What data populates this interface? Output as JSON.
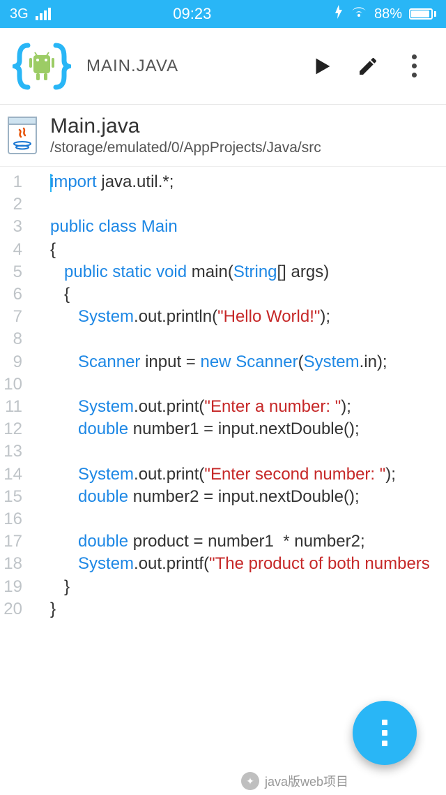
{
  "status": {
    "network": "3G",
    "time": "09:23",
    "battery_pct": "88%"
  },
  "appbar": {
    "title": "MAIN.JAVA"
  },
  "file": {
    "name": "Main.java",
    "path": "/storage/emulated/0/AppProjects/Java/src"
  },
  "code": {
    "lines": [
      [
        {
          "t": "import ",
          "c": "kw"
        },
        {
          "t": "java.util.*;",
          "c": "id"
        }
      ],
      [],
      [
        {
          "t": "public class ",
          "c": "kw"
        },
        {
          "t": "Main",
          "c": "cls"
        }
      ],
      [
        {
          "t": "{",
          "c": "id"
        }
      ],
      [
        {
          "t": "   ",
          "c": "id"
        },
        {
          "t": "public static ",
          "c": "kw"
        },
        {
          "t": "void ",
          "c": "cls"
        },
        {
          "t": "main",
          "c": "id"
        },
        {
          "t": "(",
          "c": "id"
        },
        {
          "t": "String",
          "c": "cls"
        },
        {
          "t": "[] args",
          "c": "id"
        },
        {
          "t": ")",
          "c": "id"
        }
      ],
      [
        {
          "t": "   {",
          "c": "id"
        }
      ],
      [
        {
          "t": "      ",
          "c": "id"
        },
        {
          "t": "System",
          "c": "sys"
        },
        {
          "t": ".out.println(",
          "c": "id"
        },
        {
          "t": "\"Hello World!\"",
          "c": "str"
        },
        {
          "t": ");",
          "c": "id"
        }
      ],
      [],
      [
        {
          "t": "      ",
          "c": "id"
        },
        {
          "t": "Scanner ",
          "c": "cls"
        },
        {
          "t": "input = ",
          "c": "id"
        },
        {
          "t": "new ",
          "c": "kw"
        },
        {
          "t": "Scanner",
          "c": "cls"
        },
        {
          "t": "(",
          "c": "id"
        },
        {
          "t": "System",
          "c": "sys"
        },
        {
          "t": ".in);",
          "c": "id"
        }
      ],
      [],
      [
        {
          "t": "      ",
          "c": "id"
        },
        {
          "t": "System",
          "c": "sys"
        },
        {
          "t": ".out.print(",
          "c": "id"
        },
        {
          "t": "\"Enter a number: \"",
          "c": "str"
        },
        {
          "t": ");",
          "c": "id"
        }
      ],
      [
        {
          "t": "      ",
          "c": "id"
        },
        {
          "t": "double ",
          "c": "kw"
        },
        {
          "t": "number1 = input.nextDouble();",
          "c": "id"
        }
      ],
      [],
      [
        {
          "t": "      ",
          "c": "id"
        },
        {
          "t": "System",
          "c": "sys"
        },
        {
          "t": ".out.print(",
          "c": "id"
        },
        {
          "t": "\"Enter second number: \"",
          "c": "str"
        },
        {
          "t": ");",
          "c": "id"
        }
      ],
      [
        {
          "t": "      ",
          "c": "id"
        },
        {
          "t": "double ",
          "c": "kw"
        },
        {
          "t": "number2 = input.nextDouble();",
          "c": "id"
        }
      ],
      [],
      [
        {
          "t": "      ",
          "c": "id"
        },
        {
          "t": "double ",
          "c": "kw"
        },
        {
          "t": "product = number1  * number2;",
          "c": "id"
        }
      ],
      [
        {
          "t": "      ",
          "c": "id"
        },
        {
          "t": "System",
          "c": "sys"
        },
        {
          "t": ".out.printf(",
          "c": "id"
        },
        {
          "t": "\"The product of both numbers",
          "c": "str"
        }
      ],
      [
        {
          "t": "   }",
          "c": "id"
        }
      ],
      [
        {
          "t": "}",
          "c": "id"
        }
      ]
    ]
  },
  "watermark": {
    "text": "java版web项目"
  },
  "line_count": 20
}
